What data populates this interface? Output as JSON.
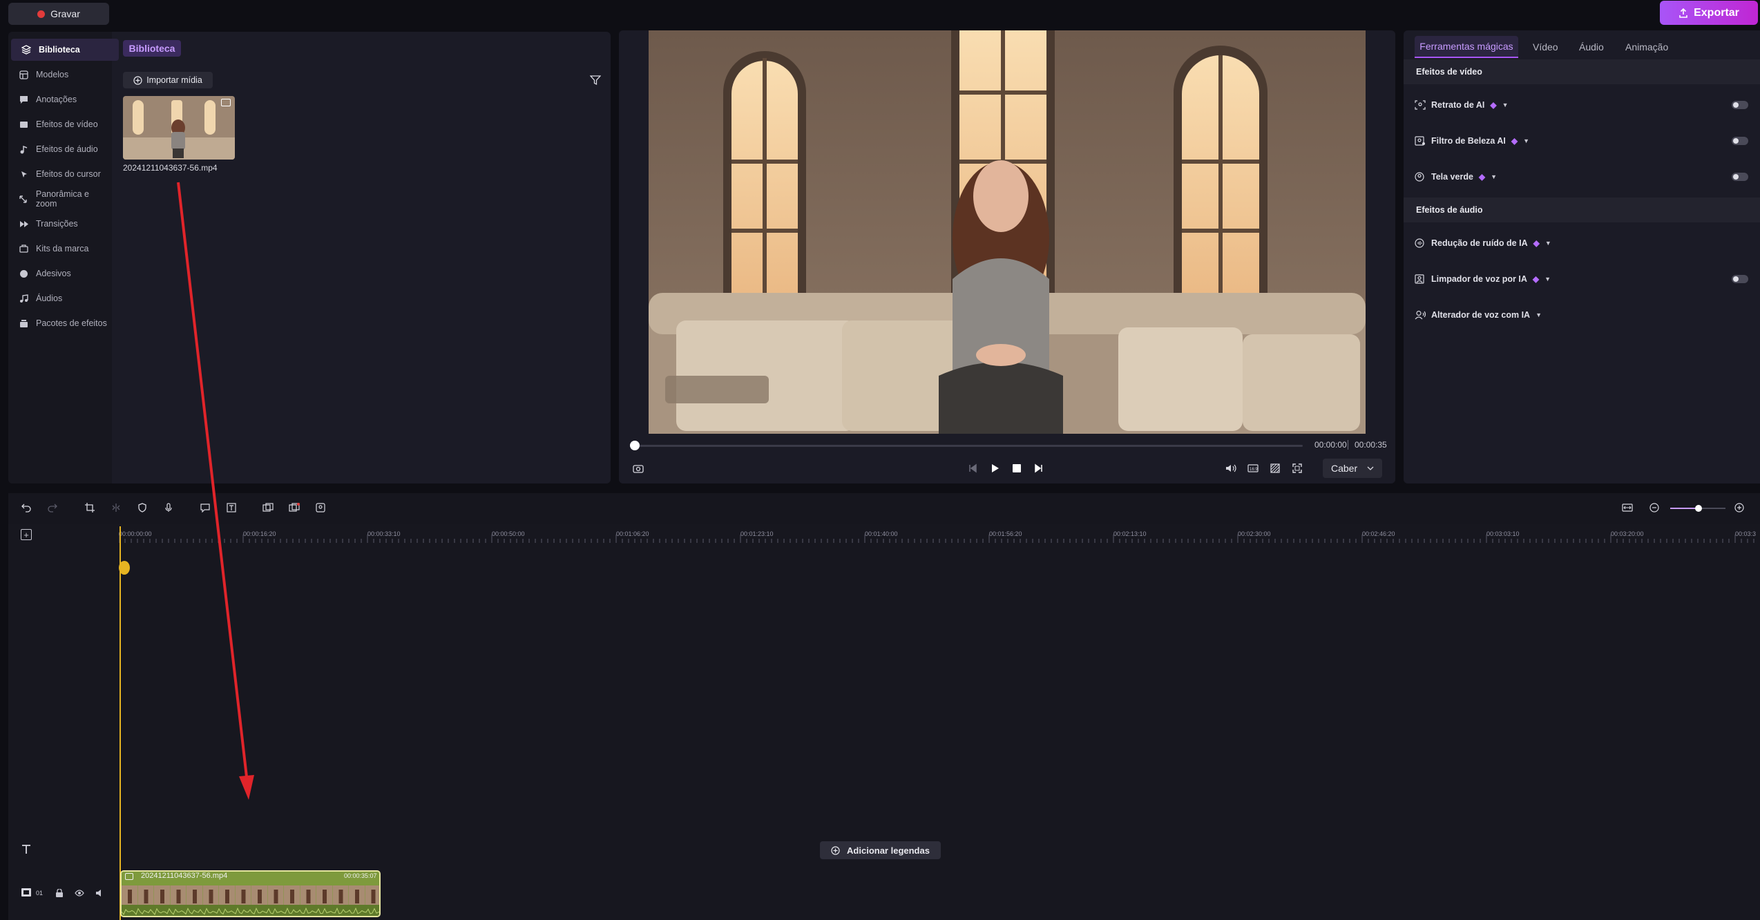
{
  "topbar": {
    "record_label": "Gravar",
    "export_label": "Exportar"
  },
  "sidebar": {
    "items": [
      {
        "label": "Biblioteca",
        "icon": "layers-icon"
      },
      {
        "label": "Modelos",
        "icon": "template-icon"
      },
      {
        "label": "Anotações",
        "icon": "annotation-icon"
      },
      {
        "label": "Efeitos de vídeo",
        "icon": "video-effects-icon"
      },
      {
        "label": "Efeitos de áudio",
        "icon": "audio-effects-icon"
      },
      {
        "label": "Efeitos do cursor",
        "icon": "cursor-icon"
      },
      {
        "label": "Panorâmica e zoom",
        "icon": "zoom-icon"
      },
      {
        "label": "Transições",
        "icon": "transition-icon"
      },
      {
        "label": "Kits da marca",
        "icon": "brand-kit-icon"
      },
      {
        "label": "Adesivos",
        "icon": "sticker-icon"
      },
      {
        "label": "Áudios",
        "icon": "music-icon"
      },
      {
        "label": "Pacotes de efeitos",
        "icon": "effects-pack-icon"
      }
    ]
  },
  "library": {
    "tab_label": "Biblioteca",
    "import_label": "Importar mídia",
    "media_file": "20241211043637-56.mp4"
  },
  "preview": {
    "time_current": "00:00:00",
    "time_total": "00:00:35",
    "fit_label": "Caber"
  },
  "right_panel": {
    "tabs": [
      "Ferramentas mágicas",
      "Vídeo",
      "Áudio",
      "Animação"
    ],
    "video_effects_header": "Efeitos de vídeo",
    "video_effects": [
      "Retrato de AI",
      "Filtro de Beleza AI",
      "Tela verde"
    ],
    "audio_effects_header": "Efeitos de áudio",
    "audio_effects": [
      "Redução de ruído de IA",
      "Limpador de voz por IA",
      "Alterador de voz com IA"
    ]
  },
  "timeline": {
    "ruler_labels": [
      "00:00:00:00",
      "00:00:16:20",
      "00:00:33:10",
      "00:00:50:00",
      "00:01:06:20",
      "00:01:23:10",
      "00:01:40:00",
      "00:01:56:20",
      "00:02:13:10",
      "00:02:30:00",
      "00:02:46:20",
      "00:03:03:10",
      "00:03:20:00",
      "00:03:3"
    ],
    "add_captions_label": "Adicionar legendas",
    "clip_name": "20241211043637-56.mp4",
    "clip_duration": "00:00:35:07",
    "track_number": "01"
  },
  "colors": {
    "accent": "#a855f7",
    "playhead": "#e6b422",
    "arrow": "#e0242a"
  }
}
